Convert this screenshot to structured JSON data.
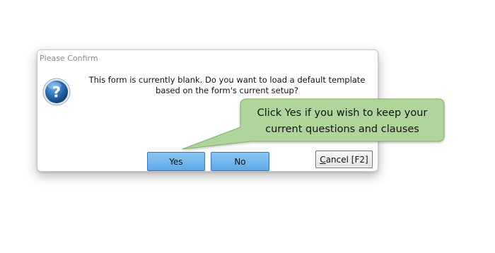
{
  "dialog": {
    "title": "Please Confirm",
    "icon": "question-icon",
    "message": "This form is currently blank. Do you want to load a default template based on the form's current setup?",
    "buttons": {
      "yes": "Yes",
      "no": "No",
      "cancel_mnemonic": "C",
      "cancel_rest": "ancel [F2]"
    }
  },
  "callout": {
    "line1": "Click Yes if you wish to keep your",
    "line2": "current questions and clauses",
    "fill": "#b0d49a",
    "border": "#86b06a"
  },
  "colors": {
    "primary_button": "#6cb4ee",
    "icon_blue": "#1b5ea3"
  }
}
